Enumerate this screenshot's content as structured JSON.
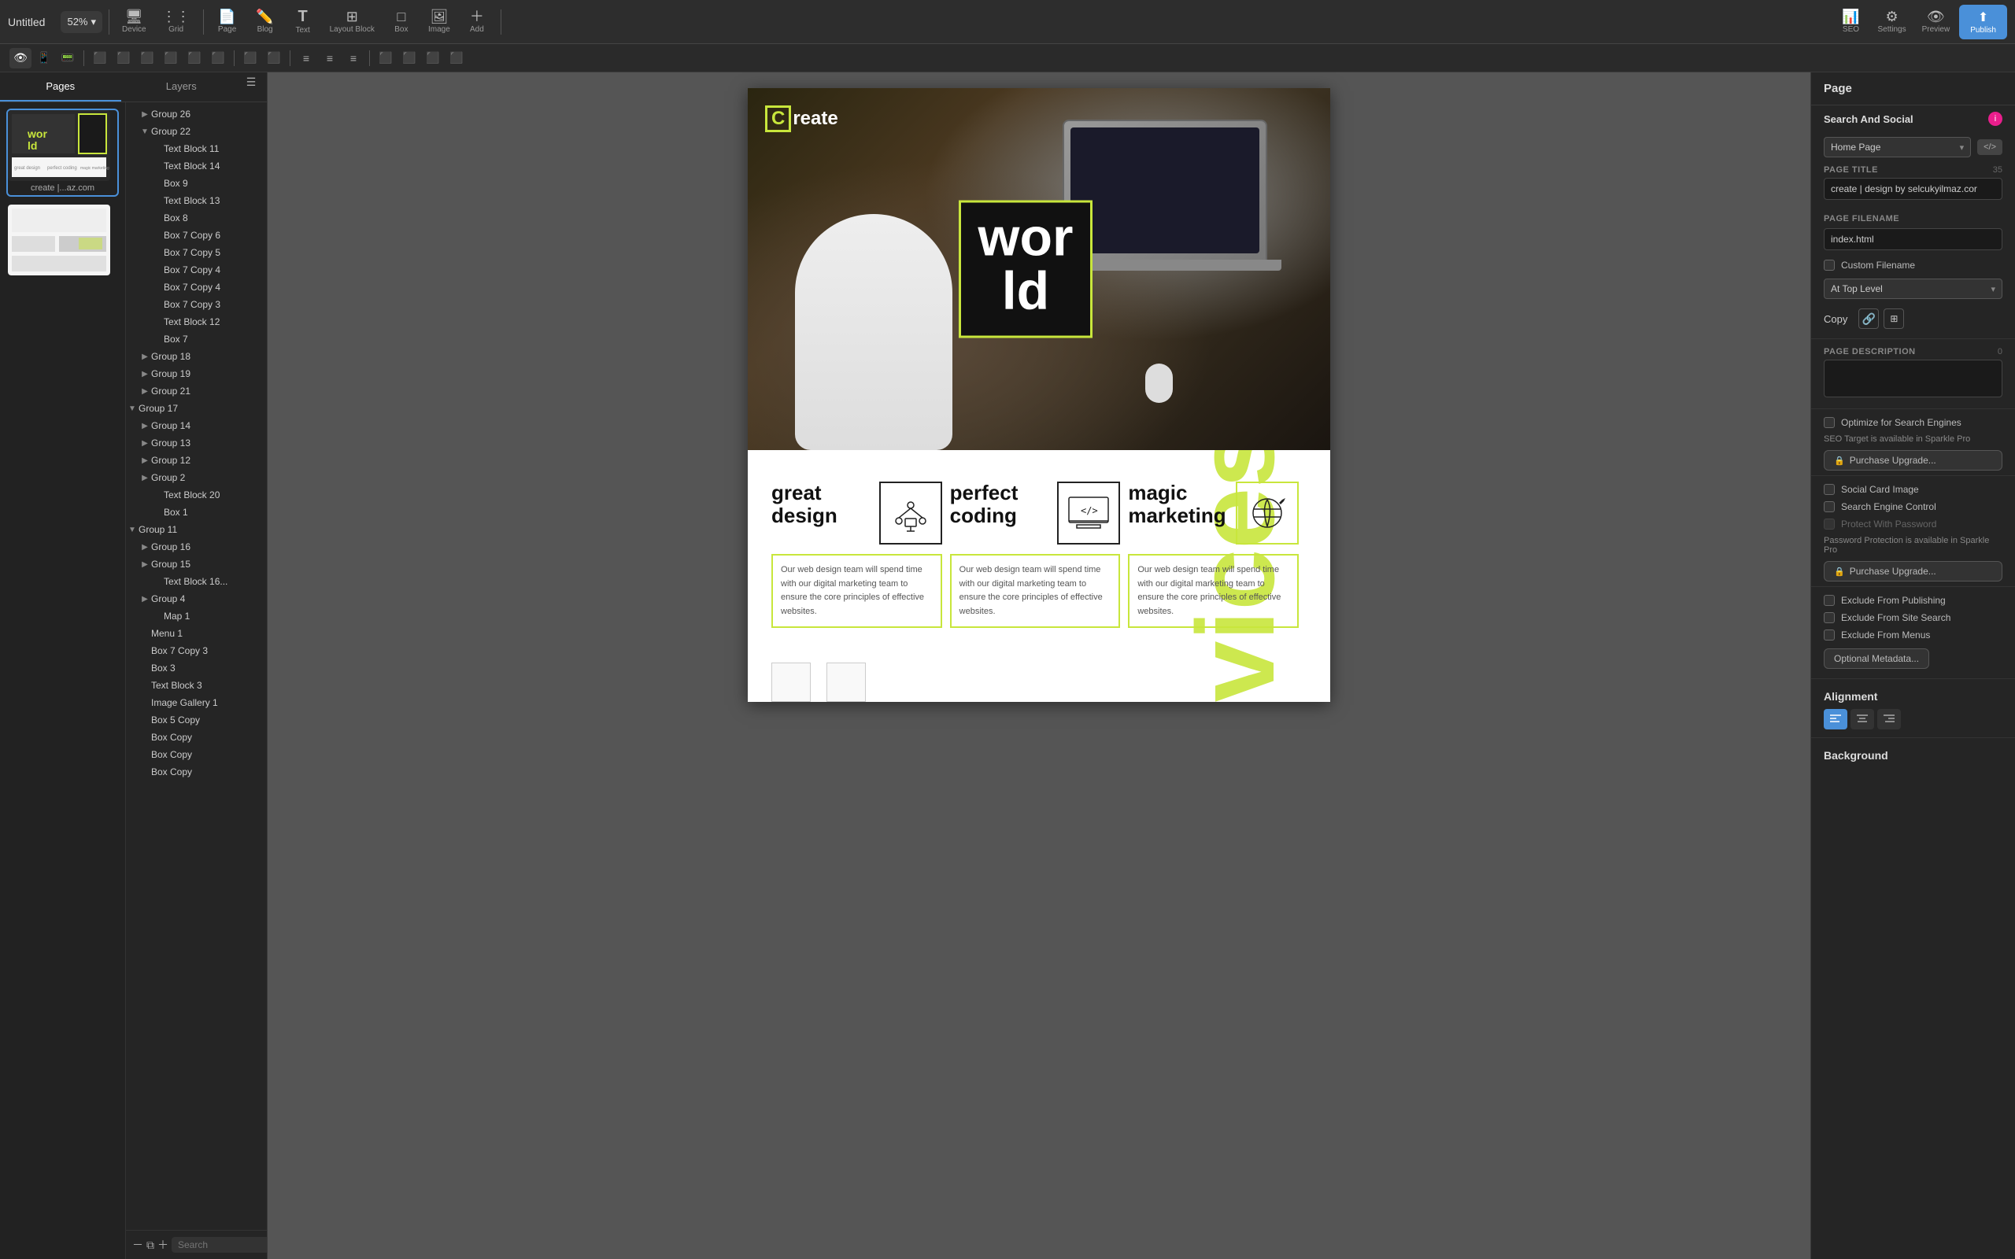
{
  "app": {
    "title": "Untitled"
  },
  "toolbar": {
    "zoom": "52%",
    "items": [
      {
        "id": "device",
        "icon": "🖥",
        "label": "Device"
      },
      {
        "id": "grid",
        "icon": "⋮⋮",
        "label": "Grid"
      },
      {
        "id": "page",
        "icon": "📄",
        "label": "Page"
      },
      {
        "id": "blog",
        "icon": "✏️",
        "label": "Blog"
      },
      {
        "id": "text",
        "icon": "T",
        "label": "Text"
      },
      {
        "id": "layout-block",
        "icon": "⊞",
        "label": "Layout Block"
      },
      {
        "id": "box",
        "icon": "□",
        "label": "Box"
      },
      {
        "id": "image",
        "icon": "🖼",
        "label": "Image"
      },
      {
        "id": "add",
        "icon": "+",
        "label": "Add"
      },
      {
        "id": "seo",
        "icon": "📊",
        "label": "SEO"
      },
      {
        "id": "settings",
        "icon": "⚙",
        "label": "Settings"
      },
      {
        "id": "preview",
        "icon": "👁",
        "label": "Preview"
      },
      {
        "id": "publish",
        "icon": "⬆",
        "label": "Publish"
      }
    ]
  },
  "panels": {
    "left": {
      "pages_label": "Pages",
      "layers_label": "Layers"
    }
  },
  "layers": [
    {
      "id": "group26",
      "name": "Group 26",
      "indent": 0,
      "expanded": false,
      "toggle": "▶"
    },
    {
      "id": "group22",
      "name": "Group 22",
      "indent": 1,
      "expanded": true,
      "toggle": "▼"
    },
    {
      "id": "text11",
      "name": "Text Block 11",
      "indent": 2,
      "toggle": ""
    },
    {
      "id": "text14",
      "name": "Text Block 14",
      "indent": 2,
      "toggle": ""
    },
    {
      "id": "box9",
      "name": "Box 9",
      "indent": 2,
      "toggle": ""
    },
    {
      "id": "text13",
      "name": "Text Block 13",
      "indent": 2,
      "toggle": ""
    },
    {
      "id": "box8",
      "name": "Box 8",
      "indent": 2,
      "toggle": ""
    },
    {
      "id": "box7c6",
      "name": "Box 7 Copy 6",
      "indent": 2,
      "toggle": ""
    },
    {
      "id": "box7c5",
      "name": "Box 7 Copy 5",
      "indent": 2,
      "toggle": ""
    },
    {
      "id": "box7c4a",
      "name": "Box 7 Copy 4",
      "indent": 2,
      "toggle": ""
    },
    {
      "id": "box7c4b",
      "name": "Box 7 Copy 4",
      "indent": 2,
      "toggle": ""
    },
    {
      "id": "box7c3",
      "name": "Box 7 Copy 3",
      "indent": 2,
      "toggle": ""
    },
    {
      "id": "text12",
      "name": "Text Block 12",
      "indent": 2,
      "toggle": ""
    },
    {
      "id": "box7",
      "name": "Box 7",
      "indent": 2,
      "toggle": ""
    },
    {
      "id": "group18",
      "name": "Group 18",
      "indent": 1,
      "expanded": false,
      "toggle": "▶"
    },
    {
      "id": "group19",
      "name": "Group 19",
      "indent": 1,
      "expanded": false,
      "toggle": "▶"
    },
    {
      "id": "group21",
      "name": "Group 21",
      "indent": 1,
      "expanded": false,
      "toggle": "▶"
    },
    {
      "id": "group17",
      "name": "Group 17",
      "indent": 0,
      "expanded": true,
      "toggle": "▼"
    },
    {
      "id": "group14",
      "name": "Group 14",
      "indent": 1,
      "expanded": false,
      "toggle": "▶"
    },
    {
      "id": "group13",
      "name": "Group 13",
      "indent": 1,
      "expanded": false,
      "toggle": "▶"
    },
    {
      "id": "group12",
      "name": "Group 12",
      "indent": 1,
      "expanded": false,
      "toggle": "▶"
    },
    {
      "id": "group2",
      "name": "Group 2",
      "indent": 1,
      "expanded": false,
      "toggle": "▶"
    },
    {
      "id": "text20",
      "name": "Text Block 20",
      "indent": 2,
      "toggle": ""
    },
    {
      "id": "box1",
      "name": "Box 1",
      "indent": 2,
      "toggle": ""
    },
    {
      "id": "group11",
      "name": "Group 11",
      "indent": 0,
      "expanded": true,
      "toggle": "▼"
    },
    {
      "id": "group16",
      "name": "Group 16",
      "indent": 1,
      "expanded": false,
      "toggle": "▶"
    },
    {
      "id": "group15",
      "name": "Group 15",
      "indent": 1,
      "expanded": false,
      "toggle": "▶"
    },
    {
      "id": "text16",
      "name": "Text Block 16...",
      "indent": 2,
      "toggle": ""
    },
    {
      "id": "group4",
      "name": "Group 4",
      "indent": 1,
      "expanded": false,
      "toggle": "▶"
    },
    {
      "id": "map1",
      "name": "Map 1",
      "indent": 2,
      "toggle": ""
    },
    {
      "id": "menu1",
      "name": "Menu 1",
      "indent": 1,
      "toggle": ""
    },
    {
      "id": "box7c3b",
      "name": "Box 7 Copy 3",
      "indent": 1,
      "toggle": ""
    },
    {
      "id": "box3",
      "name": "Box 3",
      "indent": 1,
      "toggle": ""
    },
    {
      "id": "text3",
      "name": "Text Block 3",
      "indent": 1,
      "toggle": ""
    },
    {
      "id": "image1",
      "name": "Image Gallery 1",
      "indent": 1,
      "toggle": ""
    }
  ],
  "additional_layers": [
    {
      "name": "Box 5 Copy",
      "indent": 1
    },
    {
      "name": "Box Copy",
      "indent": 1
    },
    {
      "name": "Box Copy",
      "indent": 1
    },
    {
      "name": "Box Copy",
      "indent": 1
    }
  ],
  "right_panel": {
    "header": "Page",
    "search_social": {
      "title": "Search And Social",
      "home_page": "Home Page",
      "page_title_label": "PAGE TITLE",
      "page_title_value": "create | design by selcukyilmaz.cor",
      "page_title_count": "35",
      "page_filename_label": "PAGE FILENAME",
      "page_filename_value": "index.html",
      "custom_filename_label": "Custom Filename",
      "at_top_level": "At Top Level",
      "copy_label": "Copy",
      "page_description_label": "PAGE DESCRIPTION",
      "page_description_count": "0",
      "optimize_label": "Optimize for Search Engines",
      "seo_target_label": "SEO Target is available in Sparkle Pro",
      "purchase_upgrade": "Purchase Upgrade...",
      "social_card_label": "Social Card Image",
      "search_engine_label": "Search Engine Control",
      "protect_label": "Protect With Password",
      "password_protection_note": "Password Protection is available in Sparkle Pro",
      "purchase_upgrade2": "Purchase Upgrade...",
      "exclude_publishing": "Exclude From Publishing",
      "exclude_search": "Exclude From Site Search",
      "exclude_menus": "Exclude From Menus",
      "optional_metadata": "Optional Metadata..."
    },
    "alignment": {
      "title": "Alignment",
      "options": [
        "left",
        "center",
        "right"
      ]
    },
    "background": {
      "title": "Background"
    }
  },
  "canvas": {
    "hero": {
      "logo_text": "reate",
      "logo_prefix": "C",
      "world_text": "wor\nld",
      "world_text_display": "world"
    },
    "services": {
      "card1": {
        "title": "great design",
        "desc": "Our web design team will spend time with our digital marketing team to ensure the core principles of effective websites."
      },
      "card2": {
        "title": "perfect coding",
        "desc": "Our web design team will spend time with our digital marketing team to ensure the core principles of effective websites."
      },
      "card3": {
        "title": "magic marketing",
        "desc": "Our web design team will spend time with our digital marketing team to ensure the core principles of effective websites."
      },
      "bg_word": "ervices"
    }
  },
  "search_placeholder": "Search"
}
